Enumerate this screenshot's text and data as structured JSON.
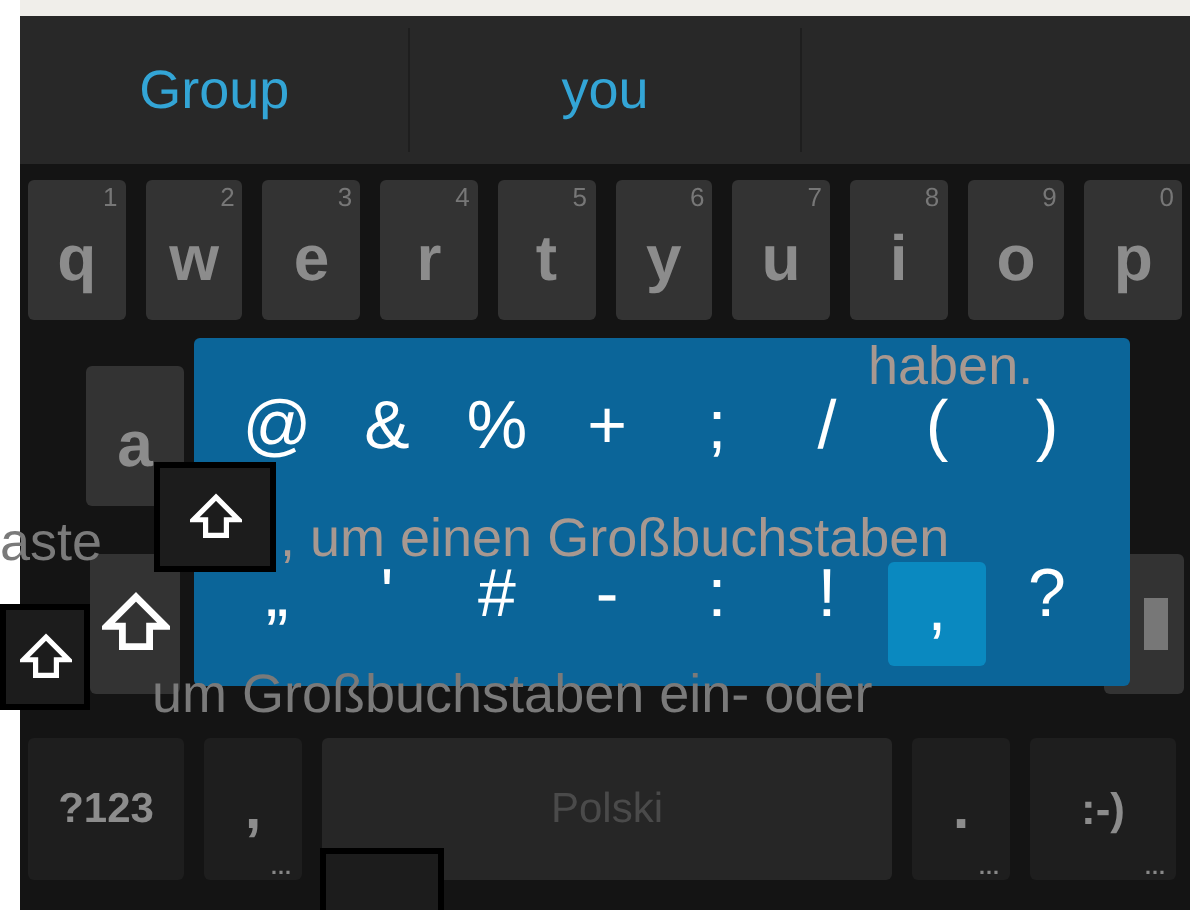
{
  "suggestions": [
    {
      "text": "Group"
    },
    {
      "text": "you"
    }
  ],
  "keyboard": {
    "row_1": [
      {
        "label": "q",
        "hint": "1"
      },
      {
        "label": "w",
        "hint": "2"
      },
      {
        "label": "e",
        "hint": "3"
      },
      {
        "label": "r",
        "hint": "4"
      },
      {
        "label": "t",
        "hint": "5"
      },
      {
        "label": "y",
        "hint": "6"
      },
      {
        "label": "u",
        "hint": "7"
      },
      {
        "label": "i",
        "hint": "8"
      },
      {
        "label": "o",
        "hint": "9"
      },
      {
        "label": "p",
        "hint": "0"
      }
    ],
    "row_2": [
      {
        "label": "a"
      }
    ],
    "bottom_row": [
      {
        "kind": "mode",
        "label": "?123"
      },
      {
        "kind": "punct",
        "label": ",",
        "hint": "…"
      },
      {
        "kind": "space",
        "label": "Polski"
      },
      {
        "kind": "punct",
        "label": ".",
        "hint": "…"
      },
      {
        "kind": "punct",
        "label": ":-)",
        "hint": "…"
      }
    ]
  },
  "popup": {
    "rows": [
      [
        {
          "symbol": "@",
          "selected": false
        },
        {
          "symbol": "&",
          "selected": false
        },
        {
          "symbol": "%",
          "selected": false
        },
        {
          "symbol": "+",
          "selected": false
        },
        {
          "symbol": ";",
          "selected": false
        },
        {
          "symbol": "/",
          "selected": false
        },
        {
          "symbol": "(",
          "selected": false
        },
        {
          "symbol": ")",
          "selected": false
        }
      ],
      [
        {
          "symbol": "„",
          "selected": false
        },
        {
          "symbol": "'",
          "selected": false
        },
        {
          "symbol": "#",
          "selected": false
        },
        {
          "symbol": "-",
          "selected": false
        },
        {
          "symbol": ":",
          "selected": false
        },
        {
          "symbol": "!",
          "selected": false
        },
        {
          "symbol": ",",
          "selected": true
        },
        {
          "symbol": "?",
          "selected": false
        }
      ]
    ]
  },
  "overlay_texts": [
    "haben.",
    "aste",
    ", um einen Großbuchstaben",
    "um  Großbuchstaben  ein-  oder"
  ]
}
